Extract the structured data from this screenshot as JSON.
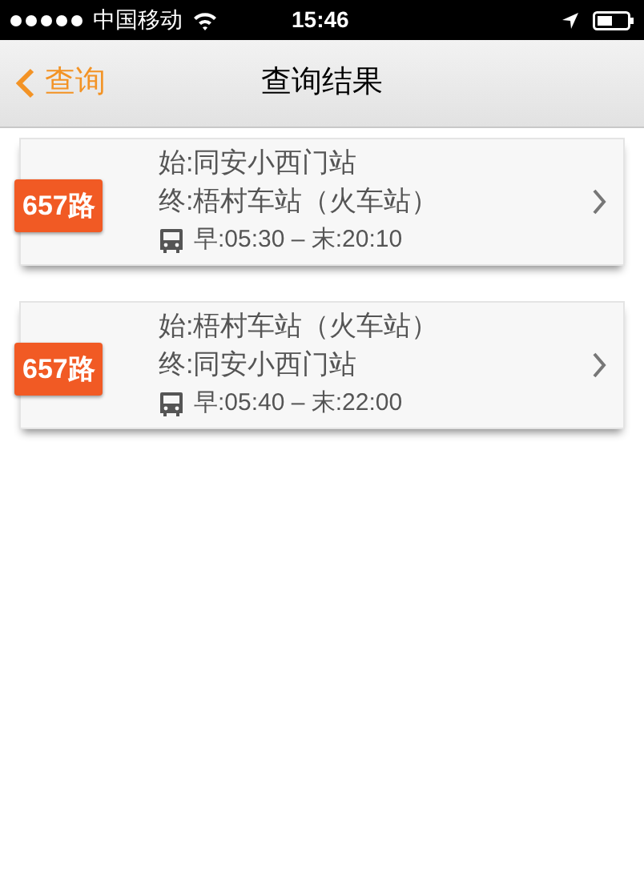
{
  "status_bar": {
    "carrier": "中国移动",
    "time": "15:46"
  },
  "nav": {
    "back": "查询",
    "title": "查询结果"
  },
  "routes": [
    {
      "badge": "657路",
      "start": "始:同安小西门站",
      "end": "终:梧村车站（火车站）",
      "hours": "早:05:30 – 末:20:10"
    },
    {
      "badge": "657路",
      "start": "始:梧村车站（火车站）",
      "end": "终:同安小西门站",
      "hours": "早:05:40 – 末:22:00"
    }
  ]
}
